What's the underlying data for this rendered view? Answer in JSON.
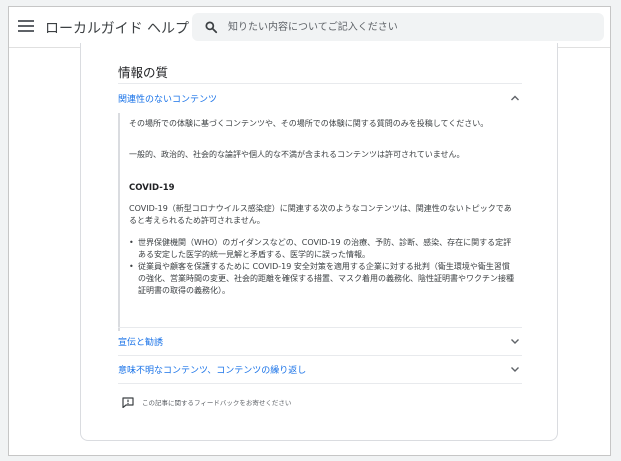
{
  "header": {
    "app_title": "ローカルガイド ヘルプ",
    "search_placeholder": "知りたい内容についてご記入ください"
  },
  "article": {
    "section_title": "情報の質",
    "accordions": [
      {
        "label": "関連性のないコンテンツ",
        "expanded": true,
        "paragraphs": [
          "その場所での体験に基づくコンテンツや、その場所での体験に関する質問のみを投稿してください。",
          "一般的、政治的、社会的な論評や個人的な不満が含まれるコンテンツは許可されていません。"
        ],
        "subheading": "COVID-19",
        "sub_paragraph": "COVID-19（新型コロナウイルス感染症）に関連する次のようなコンテンツは、関連性のないトピックであると考えられるため許可されません。",
        "bullets": [
          "世界保健機関（WHO）のガイダンスなどの、COVID-19 の治療、予防、診断、感染、存在に関する定評ある安定した医学的統一見解と矛盾する、医学的に誤った情報。",
          "従業員や顧客を保護するために COVID-19 安全対策を適用する企業に対する批判（衛生環境や衛生習慣の強化、営業時間の変更、社会的距離を確保する措置、マスク着用の義務化、陰性証明書やワクチン接種証明書の取得の義務化）。"
        ]
      },
      {
        "label": "宣伝と勧誘",
        "expanded": false
      },
      {
        "label": "意味不明なコンテンツ、コンテンツの繰り返し",
        "expanded": false
      }
    ],
    "feedback_label": "この記事に関するフィードバックをお寄せください"
  },
  "colors": {
    "link": "#1a73e8",
    "text": "#202124",
    "muted": "#5f6368",
    "divider": "#e8eaed"
  },
  "icons": {
    "menu": "hamburger-menu-icon",
    "search": "search-icon",
    "chevron_up": "chevron-up-icon",
    "chevron_down": "chevron-down-icon",
    "feedback": "feedback-icon"
  }
}
